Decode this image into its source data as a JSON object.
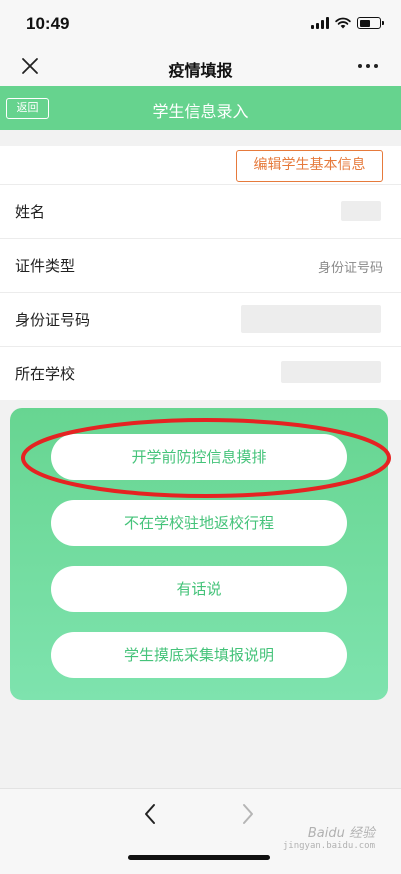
{
  "status_bar": {
    "time": "10:49",
    "signal_icon": "signal-icon",
    "wifi_icon": "wifi-icon",
    "battery_icon": "battery-icon"
  },
  "nav": {
    "title": "疫情填报",
    "close_icon": "close-icon",
    "more_icon": "more-icon"
  },
  "header": {
    "back_label": "返回",
    "title": "学生信息录入",
    "color": "#66d38e"
  },
  "form": {
    "edit_button": "编辑学生基本信息",
    "fields": [
      {
        "label": "姓名",
        "value": ""
      },
      {
        "label": "证件类型",
        "value": "身份证号码"
      },
      {
        "label": "身份证号码",
        "value": ""
      },
      {
        "label": "所在学校",
        "value": ""
      }
    ]
  },
  "actions": [
    {
      "label": "开学前防控信息摸排",
      "highlighted": true
    },
    {
      "label": "不在学校驻地返校行程"
    },
    {
      "label": "有话说"
    },
    {
      "label": "学生摸底采集填报说明"
    }
  ],
  "bottom_nav": {
    "back_icon": "chevron-left-icon",
    "forward_icon": "chevron-right-icon"
  },
  "watermark": {
    "text": "Baidu 经验",
    "sub": "jingyan.baidu.com"
  },
  "colors": {
    "accent_orange": "#e67a3c",
    "green": "#66d38e",
    "highlight_red": "#e52322"
  }
}
